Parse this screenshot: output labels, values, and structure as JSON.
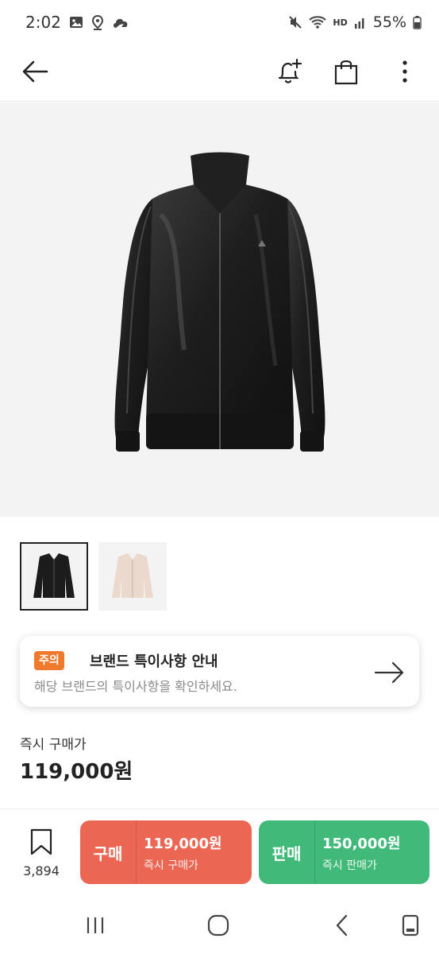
{
  "status_bar": {
    "time": "2:02",
    "hd_label": "HD",
    "battery": "55%",
    "icons": [
      "gallery-icon",
      "location-icon",
      "cloud-icon",
      "mute-icon",
      "wifi-icon",
      "signal-icon",
      "battery-icon"
    ]
  },
  "app_bar": {
    "icons": [
      "back-arrow-icon",
      "bell-add-icon",
      "shopping-bag-icon",
      "more-vert-icon"
    ]
  },
  "product": {
    "image": "black-track-jacket",
    "thumbnails": [
      "black-jacket",
      "beige-jacket"
    ],
    "active_thumbnail": 0
  },
  "notice": {
    "badge": "주의",
    "title": "브랜드 특이사항 안내",
    "desc": "해당 브랜드의 특이사항을 확인하세요.",
    "badge_color": "#ef7a2d"
  },
  "price": {
    "label": "즉시 구매가",
    "value": "119,000원"
  },
  "actions": {
    "wish_count": "3,894",
    "buy": {
      "kind": "구매",
      "amount": "119,000원",
      "sub": "즉시 구매가",
      "color": "#eb6754"
    },
    "sell": {
      "kind": "판매",
      "amount": "150,000원",
      "sub": "즉시 판매가",
      "color": "#41b979"
    }
  },
  "nav_bar": {
    "icons": [
      "recents-icon",
      "home-icon",
      "back-icon",
      "rotate-icon"
    ]
  }
}
